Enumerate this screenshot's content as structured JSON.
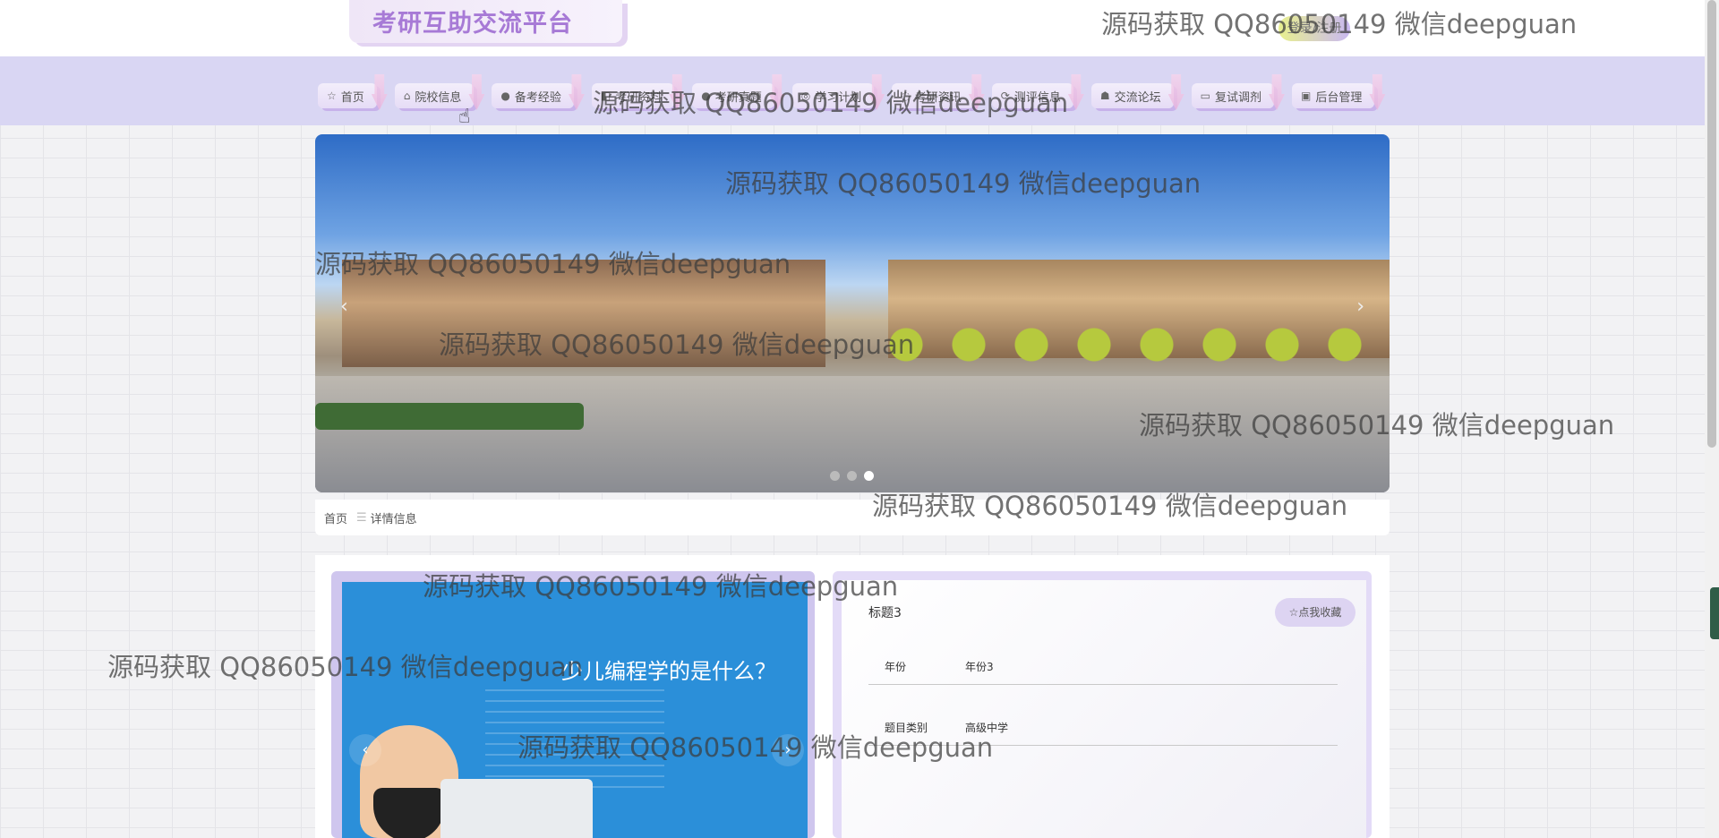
{
  "header": {
    "logo_text": "考研互助交流平台",
    "login_label": "登录/注册"
  },
  "nav": {
    "items": [
      {
        "icon": "☆",
        "label": "首页"
      },
      {
        "icon": "⌂",
        "label": "院校信息"
      },
      {
        "icon": "●",
        "label": "备考经验"
      },
      {
        "icon": "◧",
        "label": "考研资料"
      },
      {
        "icon": "●",
        "label": "考研真题"
      },
      {
        "icon": "◎",
        "label": "学习计划"
      },
      {
        "icon": "◌",
        "label": "考研资讯"
      },
      {
        "icon": "⟳",
        "label": "测评信息"
      },
      {
        "icon": "☗",
        "label": "交流论坛"
      },
      {
        "icon": "▭",
        "label": "复试调剂"
      },
      {
        "icon": "▣",
        "label": "后台管理"
      }
    ]
  },
  "banner": {
    "prev": "‹",
    "next": "›",
    "slide_count": 3,
    "active_slide": 3
  },
  "breadcrumb": {
    "home": "首页",
    "separator": "☰",
    "current": "详情信息"
  },
  "detail": {
    "gallery_title": "少儿编程学的是什么？",
    "gallery_prev": "‹",
    "gallery_next": "›",
    "title": "标题3",
    "favorite_label": "☆点我收藏",
    "fields": [
      {
        "key": "年份",
        "value": "年份3"
      },
      {
        "key": "题目类别",
        "value": "高级中学"
      }
    ]
  },
  "watermark": "源码获取 QQ86050149 微信deepguan",
  "colors": {
    "accent": "#a77ad6",
    "nav_bg": "#d9d6f3",
    "gallery_bg": "#2b8fd9"
  }
}
